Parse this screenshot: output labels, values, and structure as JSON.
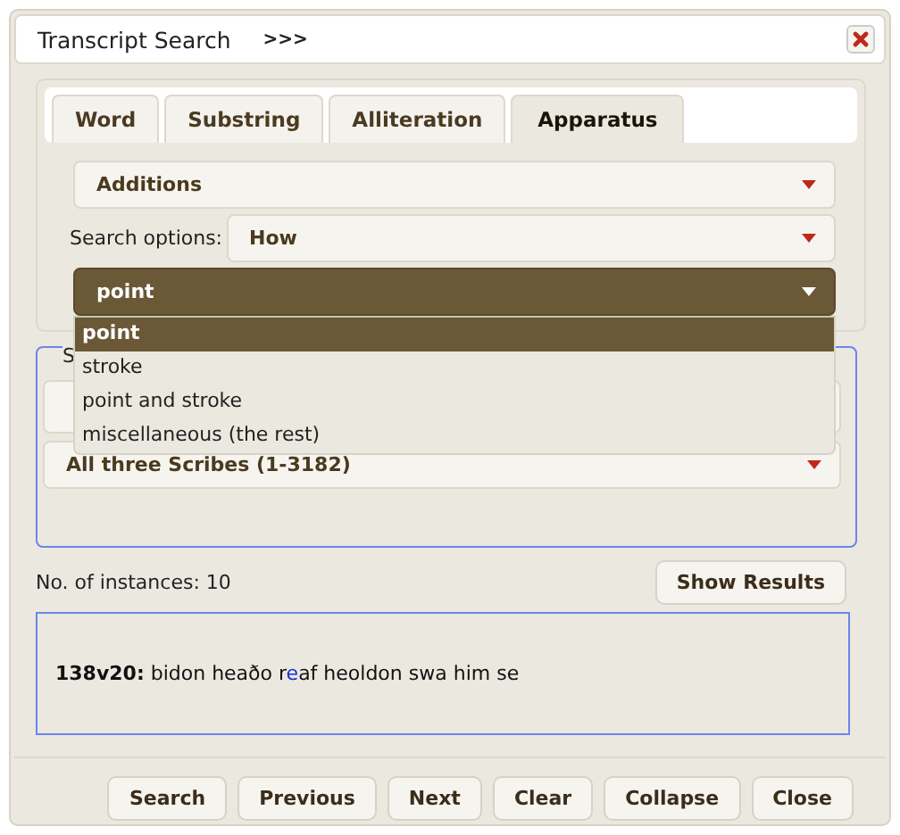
{
  "window": {
    "title": "Transcript Search",
    "expand_label": ">>>"
  },
  "tabs": [
    {
      "label": "Word",
      "selected": false
    },
    {
      "label": "Substring",
      "selected": false
    },
    {
      "label": "Alliteration",
      "selected": false
    },
    {
      "label": "Apparatus",
      "selected": true
    }
  ],
  "category_select": {
    "value": "Additions"
  },
  "search_options": {
    "label": "Search options:",
    "value": "How"
  },
  "type_select": {
    "value": "point",
    "expanded": true,
    "options": [
      {
        "label": "point",
        "selected": true
      },
      {
        "label": "stroke",
        "selected": false
      },
      {
        "label": "point and stroke",
        "selected": false
      },
      {
        "label": "miscellaneous (the rest)",
        "selected": false
      }
    ]
  },
  "scope": {
    "legend": "S",
    "scribe_select": {
      "value": "All three Scribes (1-3182)"
    }
  },
  "instances": {
    "label": "No. of instances: 10",
    "button": "Show Results"
  },
  "results": [
    {
      "ref": "138v20:",
      "parts": [
        {
          "text": "bidon heaðo r",
          "highlight": false
        },
        {
          "text": "e",
          "highlight": true
        },
        {
          "text": "af heoldon swa him se",
          "highlight": false
        }
      ]
    }
  ],
  "buttons": [
    "Search",
    "Previous",
    "Next",
    "Clear",
    "Collapse",
    "Close"
  ]
}
